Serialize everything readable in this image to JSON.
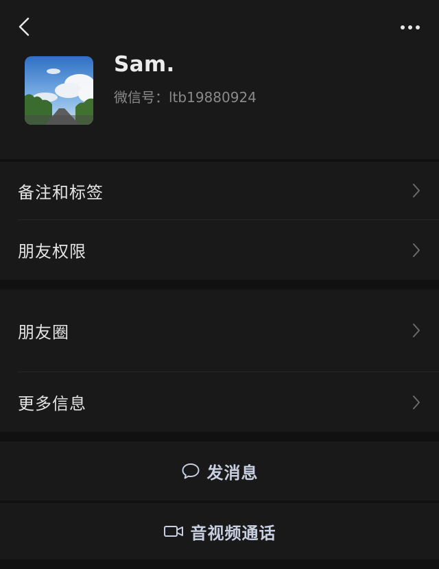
{
  "header": {
    "back_icon": "chevron-left-icon",
    "more_icon": "more-dots-icon",
    "avatar_image": "sky-road-landscape"
  },
  "profile": {
    "name": "Sam.",
    "wechat_id_label": "微信号：",
    "wechat_id": "ltb19880924"
  },
  "menu_groups": [
    {
      "items": [
        {
          "label": "备注和标签"
        },
        {
          "label": "朋友权限"
        }
      ]
    },
    {
      "items": [
        {
          "label": "朋友圈"
        },
        {
          "label": "更多信息"
        }
      ]
    }
  ],
  "actions": {
    "send_message": {
      "label": "发消息",
      "icon": "chat-bubble-icon"
    },
    "av_call": {
      "label": "音视频通话",
      "icon": "video-camera-icon"
    }
  },
  "colors": {
    "background": "#111111",
    "surface": "#191919",
    "text_primary": "#e4e4e4",
    "text_secondary": "#8a8a8a",
    "link_text": "#c7cfe0",
    "divider": "#262626"
  }
}
